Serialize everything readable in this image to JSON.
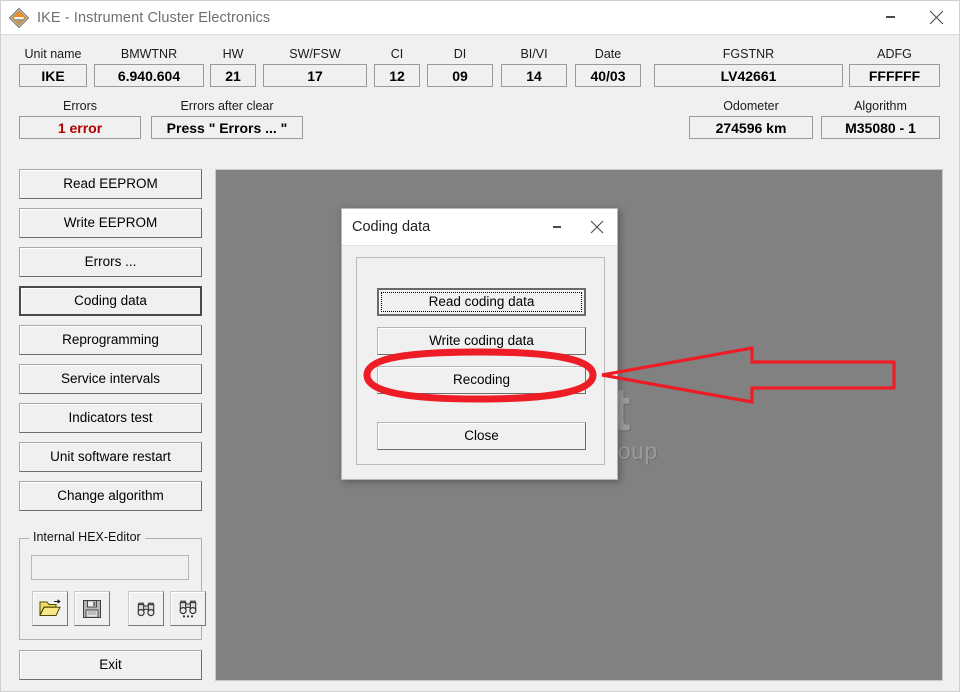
{
  "window": {
    "title": "IKE - Instrument Cluster Electronics",
    "icon": "bmw-diamond-icon",
    "minimize_label": "–",
    "close_label": "✕"
  },
  "header": {
    "fields": [
      {
        "label": "Unit name",
        "value": "IKE"
      },
      {
        "label": "BMWTNR",
        "value": "6.940.604"
      },
      {
        "label": "HW",
        "value": "21"
      },
      {
        "label": "SW/FSW",
        "value": "17"
      },
      {
        "label": "CI",
        "value": "12"
      },
      {
        "label": "DI",
        "value": "09"
      },
      {
        "label": "BI/VI",
        "value": "14"
      },
      {
        "label": "Date",
        "value": "40/03"
      },
      {
        "label": "FGSTNR",
        "value": "LV42661"
      },
      {
        "label": "ADFG",
        "value": "FFFFFF"
      }
    ],
    "second_row": [
      {
        "label": "Errors",
        "value": "1 error",
        "color": "#b00000"
      },
      {
        "label": "Errors after clear",
        "value": "Press \" Errors ... \""
      },
      {
        "label": "Odometer",
        "value": "274596 km"
      },
      {
        "label": "Algorithm",
        "value": "M35080 - 1"
      }
    ]
  },
  "sidebar": {
    "buttons": [
      {
        "label": "Read EEPROM",
        "focused": false
      },
      {
        "label": "Write EEPROM",
        "focused": false
      },
      {
        "label": "Errors ...",
        "focused": false
      },
      {
        "label": "Coding data",
        "focused": true
      },
      {
        "label": "Reprogramming",
        "focused": false
      },
      {
        "label": "Service intervals",
        "focused": false
      },
      {
        "label": "Indicators test",
        "focused": false
      },
      {
        "label": "Unit software restart",
        "focused": false
      },
      {
        "label": "Change algorithm",
        "focused": false
      }
    ],
    "hex_editor": {
      "title": "Internal HEX-Editor",
      "field_value": "",
      "icons": [
        {
          "name": "open-folder-icon"
        },
        {
          "name": "save-floppy-icon"
        },
        {
          "name": "find-binoculars-icon"
        },
        {
          "name": "find-next-binoculars-icon"
        }
      ]
    },
    "exit_label": "Exit"
  },
  "workspace": {
    "watermark_line1": "oft",
    "watermark_line2": "ent group",
    "background_color": "#818181"
  },
  "dialog": {
    "title": "Coding data",
    "minimize_label": "–",
    "close_label": "✕",
    "buttons": [
      {
        "label": "Read coding data",
        "default": true,
        "highlighted": false
      },
      {
        "label": "Write coding data",
        "default": false,
        "highlighted": false
      },
      {
        "label": "Recoding",
        "default": false,
        "highlighted": true
      },
      {
        "label": "Close",
        "default": false,
        "highlighted": false
      }
    ]
  },
  "annotation": {
    "color": "#ee1c25",
    "ellipse_target": "Recoding",
    "arrow_direction": "left"
  }
}
